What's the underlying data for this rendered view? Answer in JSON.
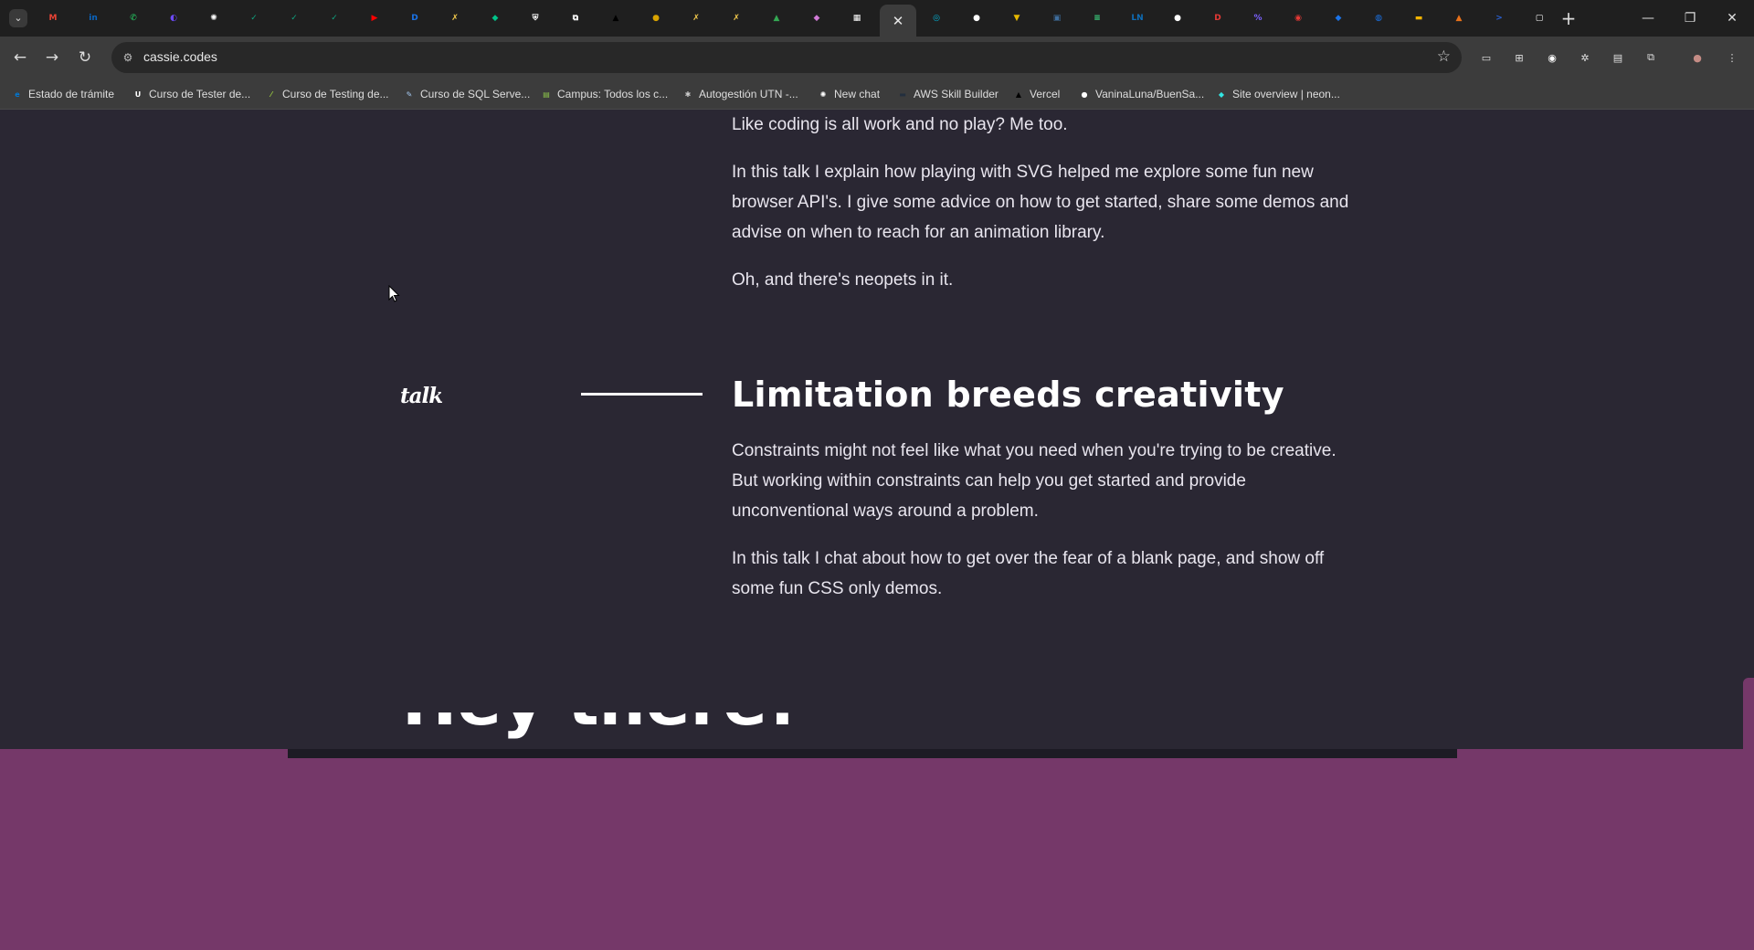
{
  "browser": {
    "tabs": [
      {
        "icon": "chevron-down-icon"
      },
      {
        "icon": "gmail-icon",
        "color": "#ea4335",
        "glyph": "M"
      },
      {
        "icon": "linkedin-icon",
        "color": "#0a66c2",
        "glyph": "in"
      },
      {
        "icon": "whatsapp-icon",
        "color": "#25d366",
        "glyph": "✆"
      },
      {
        "icon": "proton-icon",
        "color": "#6d4aff",
        "glyph": "◐"
      },
      {
        "icon": "openai-icon",
        "color": "#ffffff",
        "glyph": "✺"
      },
      {
        "icon": "chatgpt-icon",
        "color": "#10a37f",
        "glyph": "✓"
      },
      {
        "icon": "chatgpt-icon",
        "color": "#10a37f",
        "glyph": "✓"
      },
      {
        "icon": "chatgpt-icon",
        "color": "#10a37f",
        "glyph": "✓"
      },
      {
        "icon": "youtube-icon",
        "color": "#ff0000",
        "glyph": "▶"
      },
      {
        "icon": "app-icon",
        "color": "#1a73e8",
        "glyph": "D"
      },
      {
        "icon": "tool-icon",
        "color": "#f2c94c",
        "glyph": "✗"
      },
      {
        "icon": "diamond-icon",
        "color": "#00c389",
        "glyph": "◆"
      },
      {
        "icon": "shield-icon",
        "color": "#ffffff",
        "glyph": "⛨"
      },
      {
        "icon": "link-icon",
        "color": "#ffffff",
        "glyph": "⧉"
      },
      {
        "icon": "vercel-icon",
        "color": "#000000",
        "glyph": "▲"
      },
      {
        "icon": "app-icon",
        "color": "#d9a300",
        "glyph": "●"
      },
      {
        "icon": "tool-icon",
        "color": "#f2c94c",
        "glyph": "✗"
      },
      {
        "icon": "tool-icon",
        "color": "#f2c94c",
        "glyph": "✗"
      },
      {
        "icon": "drive-icon",
        "color": "#34a853",
        "glyph": "▲"
      },
      {
        "icon": "app-icon",
        "color": "#d07ad6",
        "glyph": "◆"
      },
      {
        "icon": "chart-icon",
        "color": "#ffffff",
        "glyph": "▦"
      }
    ],
    "active_tab": {
      "icon": "close-icon",
      "glyph": "✕"
    },
    "tabs_after": [
      {
        "icon": "app-icon",
        "color": "#00b4d8",
        "glyph": "◎"
      },
      {
        "icon": "github-icon",
        "color": "#ffffff",
        "glyph": "●"
      },
      {
        "icon": "app-icon",
        "color": "#e6b800",
        "glyph": "▼"
      },
      {
        "icon": "app-icon",
        "color": "#3f6e9e",
        "glyph": "▣"
      },
      {
        "icon": "app-icon",
        "color": "#3ddc84",
        "glyph": "≡"
      },
      {
        "icon": "app-icon",
        "color": "#0e6db7",
        "glyph": "LN"
      },
      {
        "icon": "github-icon",
        "color": "#ffffff",
        "glyph": "●"
      },
      {
        "icon": "app-icon",
        "color": "#e53935",
        "glyph": "D"
      },
      {
        "icon": "app-icon",
        "color": "#7b61ff",
        "glyph": "%"
      },
      {
        "icon": "app-icon",
        "color": "#e53935",
        "glyph": "◉"
      },
      {
        "icon": "app-icon",
        "color": "#1a73e8",
        "glyph": "◆"
      },
      {
        "icon": "globe-icon",
        "color": "#1a73e8",
        "glyph": "◍"
      },
      {
        "icon": "app-icon",
        "color": "#f4b400",
        "glyph": "▬"
      },
      {
        "icon": "app-icon",
        "color": "#e8711a",
        "glyph": "▲"
      },
      {
        "icon": "powershell-icon",
        "color": "#2a5fd1",
        "glyph": ">"
      },
      {
        "icon": "app-icon",
        "color": "#ffffff",
        "glyph": "▢"
      }
    ],
    "new_tab": "+",
    "window": {
      "minimize": "—",
      "restore": "❐",
      "close": "✕"
    },
    "nav": {
      "back": "←",
      "forward": "→",
      "reload": "↻"
    },
    "url": "cassie.codes",
    "site_info_icon": "⚙",
    "bookmark_star": "☆",
    "extensions": [
      {
        "icon": "screenshot-icon",
        "color": "#e0e0e0",
        "glyph": "▭"
      },
      {
        "icon": "translate-icon",
        "color": "#e0e0e0",
        "glyph": "⊞"
      },
      {
        "icon": "edge-icon",
        "color": "#ffffff",
        "glyph": "◉"
      },
      {
        "icon": "settings-icon",
        "color": "#e0e0e0",
        "glyph": "✲"
      },
      {
        "icon": "extension-icon",
        "color": "#e0e0e0",
        "glyph": "▤"
      },
      {
        "icon": "puzzle-icon",
        "color": "#e0e0e0",
        "glyph": "⧉"
      },
      {
        "icon": "avatar-icon",
        "color": "#c58c85",
        "glyph": "●"
      },
      {
        "icon": "menu-icon",
        "color": "#e0e0e0",
        "glyph": "⋮"
      }
    ],
    "bookmarks": [
      {
        "label": "Estado de trámite",
        "icon": "edge-icon",
        "color": "#0078d4",
        "glyph": "e"
      },
      {
        "label": "Curso de Tester de...",
        "icon": "udemy-icon",
        "color": "#ffffff",
        "glyph": "U"
      },
      {
        "label": "Curso de Testing de...",
        "icon": "app-icon",
        "color": "#98ca3f",
        "glyph": "⁄"
      },
      {
        "label": "Curso de SQL Serve...",
        "icon": "app-icon",
        "color": "#a4c8f0",
        "glyph": "✎"
      },
      {
        "label": "Campus: Todos los c...",
        "icon": "app-icon",
        "color": "#8bc34a",
        "glyph": "▤"
      },
      {
        "label": "Autogestión UTN -...",
        "icon": "app-icon",
        "color": "#cccccc",
        "glyph": "✱"
      },
      {
        "label": "New chat",
        "icon": "openai-icon",
        "color": "#ffffff",
        "glyph": "✺"
      },
      {
        "label": "AWS Skill Builder",
        "icon": "aws-icon",
        "color": "#232f3e",
        "glyph": "▬"
      },
      {
        "label": "Vercel",
        "icon": "vercel-icon",
        "color": "#000000",
        "glyph": "▲"
      },
      {
        "label": "VaninaLuna/BuenSa...",
        "icon": "github-icon",
        "color": "#ffffff",
        "glyph": "●"
      },
      {
        "label": "Site overview | neon...",
        "icon": "netlify-icon",
        "color": "#32e6e2",
        "glyph": "◆"
      }
    ]
  },
  "page": {
    "intro_p1": "Like coding is all work and no play? Me too.",
    "intro_p2": "In this talk I explain how playing with SVG helped me explore some fun new browser API's. I give some advice on how to get started, share some demos and advise on when to reach for an animation library.",
    "intro_p3": "Oh, and there's neopets in it.",
    "talk_label": "talk",
    "talk_title": "Limitation breeds creativity",
    "talk_p1": "Constraints might not feel like what you need when you're trying to be creative. But working within constraints can help you get started and provide unconventional ways around a problem.",
    "talk_p2": "In this talk I chat about how to get over the fear of a blank page, and show off some fun CSS only demos.",
    "hey_heading": "Hey there!"
  },
  "colors": {
    "background": "#2a2733",
    "purple_section": "#753869",
    "text": "#e8e5ee"
  }
}
